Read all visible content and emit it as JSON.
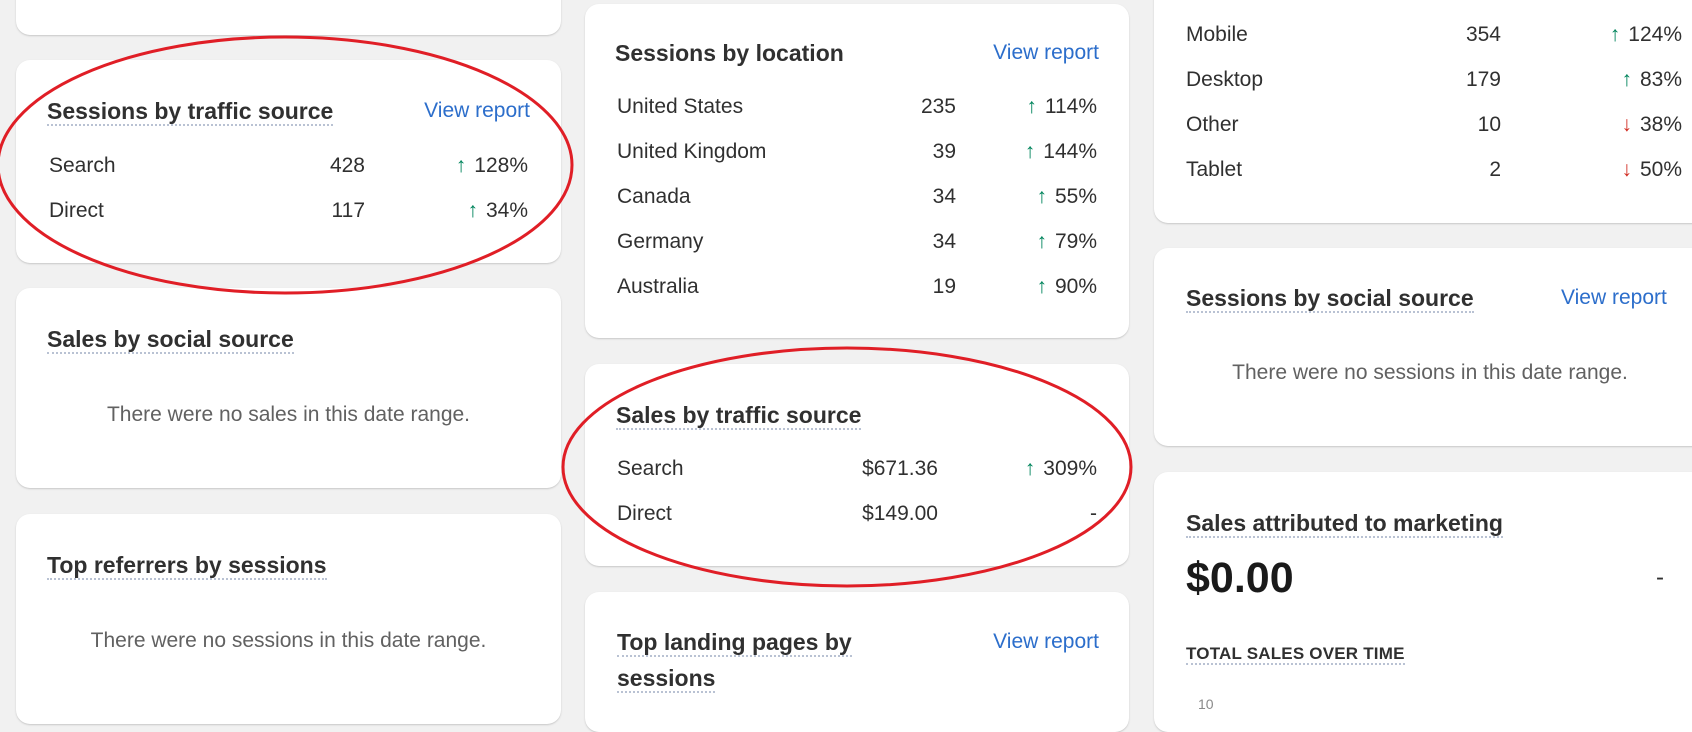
{
  "traffic_source": {
    "title": "Sessions by traffic source",
    "link": "View report",
    "rows": [
      {
        "name": "Search",
        "value": "428",
        "change": "128%",
        "dir": "up"
      },
      {
        "name": "Direct",
        "value": "117",
        "change": "34%",
        "dir": "up"
      }
    ]
  },
  "social_sales": {
    "title": "Sales by social source",
    "empty": "There were no sales in this date range."
  },
  "top_referrers": {
    "title": "Top referrers by sessions",
    "empty": "There were no sessions in this date range."
  },
  "location": {
    "title": "Sessions by location",
    "link": "View report",
    "rows": [
      {
        "name": "United States",
        "value": "235",
        "change": "114%",
        "dir": "up"
      },
      {
        "name": "United Kingdom",
        "value": "39",
        "change": "144%",
        "dir": "up"
      },
      {
        "name": "Canada",
        "value": "34",
        "change": "55%",
        "dir": "up"
      },
      {
        "name": "Germany",
        "value": "34",
        "change": "79%",
        "dir": "up"
      },
      {
        "name": "Australia",
        "value": "19",
        "change": "90%",
        "dir": "up"
      }
    ]
  },
  "sales_traffic": {
    "title": "Sales by traffic source",
    "rows": [
      {
        "name": "Search",
        "value": "$671.36",
        "change": "309%",
        "dir": "up"
      },
      {
        "name": "Direct",
        "value": "$149.00",
        "change": "-",
        "dir": "none"
      }
    ]
  },
  "landing_pages": {
    "title_line1": "Top landing pages by",
    "title_line2": "sessions",
    "link": "View report"
  },
  "device": {
    "rows": [
      {
        "name": "Mobile",
        "value": "354",
        "change": "124%",
        "dir": "up"
      },
      {
        "name": "Desktop",
        "value": "179",
        "change": "83%",
        "dir": "up"
      },
      {
        "name": "Other",
        "value": "10",
        "change": "38%",
        "dir": "down"
      },
      {
        "name": "Tablet",
        "value": "2",
        "change": "50%",
        "dir": "down"
      }
    ]
  },
  "social_sessions": {
    "title": "Sessions by social source",
    "link": "View report",
    "empty": "There were no sessions in this date range."
  },
  "marketing": {
    "title": "Sales attributed to marketing",
    "amount": "$0.00",
    "change": "-",
    "subtitle": "TOTAL SALES OVER TIME",
    "axis_tick": "10"
  },
  "icons": {
    "up": "↑",
    "down": "↓"
  },
  "colors": {
    "link": "#2c6ecb",
    "up": "#00845c",
    "down": "#d12c22",
    "annotation": "#e01e26"
  }
}
